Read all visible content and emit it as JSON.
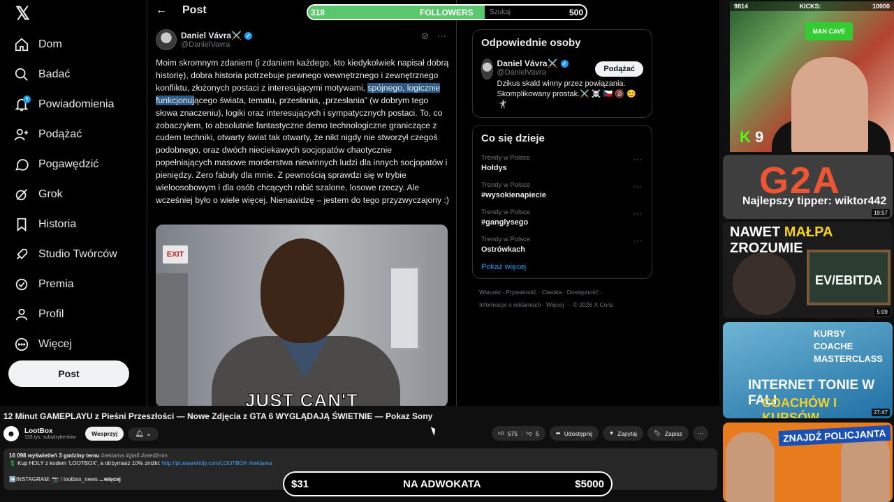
{
  "x_app": {
    "nav": [
      {
        "label": "Dom",
        "icon": "home-icon"
      },
      {
        "label": "Badać",
        "icon": "search-icon"
      },
      {
        "label": "Powiadomienia",
        "icon": "bell-icon",
        "badge": "9"
      },
      {
        "label": "Podążać",
        "icon": "follow-icon"
      },
      {
        "label": "Pogawędzić",
        "icon": "chat-icon"
      },
      {
        "label": "Grok",
        "icon": "grok-icon"
      },
      {
        "label": "Historia",
        "icon": "bookmark-icon"
      },
      {
        "label": "Studio Twórców",
        "icon": "rocket-icon"
      },
      {
        "label": "Premia",
        "icon": "premium-icon"
      },
      {
        "label": "Profil",
        "icon": "profile-icon"
      },
      {
        "label": "Więcej",
        "icon": "more-icon"
      }
    ],
    "post_button": "Post",
    "header_title": "Post",
    "post": {
      "author_name": "Daniel Vávra⚔️",
      "author_handle": "@DanielVavra",
      "text_before": "Moim skromnym zdaniem (i zdaniem każdego, kto kiedykolwiek napisał dobrą historię), dobra historia potrzebuje pewnego wewnętrznego i zewnętrznego konfliktu, złożonych postaci z interesującymi motywami, ",
      "text_highlight": "spójnego, logicznie funkcjonuj",
      "text_after": "ącego świata, tematu, przesłania, „przesłania” (w dobrym tego słowa znaczeniu), logiki oraz interesujących i sympatycznych postaci. To, co zobaczyłem, to absolutnie fantastyczne demo technologiczne graniczące z cudem techniki, otwarty świat tak otwarty, że nikt nigdy nie stworzył czegoś podobnego, oraz dwóch nieciekawych socjopatów chaotycznie popełniających masowe morderstwa niewinnych ludzi dla innych socjopatów i pieniędzy. Zero fabuły dla mnie. Z pewnością sprawdzi się w trybie wieloosobowym i dla osób chcących robić szalone, losowe rzeczy. Ale wcześniej było o wiele więcej. Nienawidzę – jestem do tego przyzwyczajony :)",
      "gif_exit": "EXIT",
      "gif_caption": "JUST CAN'T"
    },
    "relevant": {
      "title": "Odpowiednie osoby",
      "name": "Daniel Vávra⚔️",
      "handle": "@DanielVavra",
      "follow_label": "Podążać",
      "bio": "Dzikus skald winny przez powiązania. Skomplikowany prostak.⚔️ ☠️ 🇨🇿 🔞 😊 🤺"
    },
    "trends": {
      "title": "Co się dzieje",
      "items": [
        {
          "meta": "Trendy w Polsce",
          "name": "Hołdys"
        },
        {
          "meta": "Trendy w Polsce",
          "name": "#wysokienapiecie"
        },
        {
          "meta": "Trendy w Polsce",
          "name": "#ganglysego"
        },
        {
          "meta": "Trendy w Polsce",
          "name": "Ostrówkach"
        }
      ],
      "show_more": "Pokaż więcej"
    },
    "footer": {
      "line1": "Warunki  ·  Prywatność  ·  Ciastka  ·  Dostępność  ·",
      "line2": "Informacje o reklamach  ·  Więcej ···  © 2026 X Corp."
    }
  },
  "followers_bar": {
    "current": "318",
    "label": "FOLLOWERS",
    "goal": "500",
    "search_ghost": "Szukaj",
    "progress": 0.636
  },
  "webcam": {
    "left_stat": "9814",
    "kicks_label": "KICKS:",
    "kicks_value": "10000",
    "sign": "MAN CAVE",
    "kick_count": "9"
  },
  "thumbs": [
    {
      "big": "G2A",
      "tip": "Najlepszy tipper: wiktor442",
      "dur": "19:57"
    },
    {
      "head_pre": "NAWET ",
      "head_em": "MAŁPA",
      "head_post": " ZROZUMIE",
      "board": "EV/EBITDA",
      "dur": "5:09"
    },
    {
      "words": "KURSY\nCOACHE\nMASTERCLASS",
      "l1": "INTERNET TONIE W FALI",
      "l2": "COACHÓW I KURSÓW",
      "dur": "27:47"
    },
    {
      "label": "ZNAJDŹ POLICJANTA"
    }
  ],
  "video": {
    "title": "12 Minut GAMEPLAYU z Pieśni Przeszłości — Nowe Zdjęcia z GTA 6 WYGLĄDAJĄ ŚWIETNIE — Pokaz Sony",
    "channel": "LootBox",
    "subs": "133 tys. subskrybentów",
    "support": "Wesprzyj",
    "likes": "575",
    "dislikes": "5",
    "share": "Udostępnij",
    "ask": "Zapytaj",
    "save": "Zapisz",
    "views": "16 098 wyświetleń  3 godziny temu",
    "tags": "#reklama #gta6 #wiedźmin",
    "promo": "💲 Kup HOLY z kodem 'LOOTBOX', a otrzymasz 10% zniżki: ",
    "promo_link": "http://pl.weareholy.com/LOOTBOX",
    "promo_tag": "#reklama",
    "insta": "➡️INSTAGRAM: 📷 / lootbox_news",
    "more": "...więcej"
  },
  "advocate_bar": {
    "left": "$31",
    "label": "NA ADWOKATA",
    "right": "$5000"
  }
}
